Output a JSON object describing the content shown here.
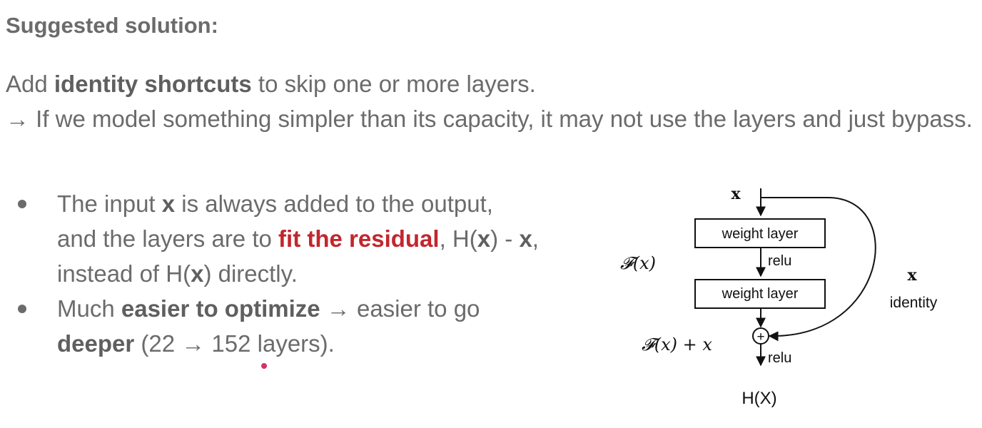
{
  "heading": "Suggested solution:",
  "p1": {
    "pre": "Add ",
    "bold": "identity shortcuts",
    "post": " to skip one or more layers."
  },
  "p2": {
    "text": "→ If we model something simpler than its capacity, it may not use the layers and just bypass."
  },
  "bullet1": {
    "t1": "The input ",
    "b1": "x",
    "t2": " is always added to the output,",
    "t3": "and the layers are to ",
    "red": "fit the residual",
    "t4": ", H(",
    "b2": "x",
    "t5": ") - ",
    "b3": "x",
    "t6": ",",
    "t7": "instead of H(",
    "b4": "x",
    "t8": ") directly."
  },
  "bullet2": {
    "t1": "Much ",
    "b1": "easier to optimize",
    "t2": " → easier to go",
    "b2": "deeper",
    "t3": " (22 → 152 layers)."
  },
  "diagram": {
    "input": "x",
    "layer1": "weight layer",
    "relu1": "relu",
    "layer2": "weight layer",
    "fx": "𝓕(x)",
    "sum_label": "𝓕(x) + x",
    "shortcut_x": "x",
    "shortcut_label": "identity",
    "plus": "+",
    "relu2": "relu",
    "output": "H(X)"
  }
}
